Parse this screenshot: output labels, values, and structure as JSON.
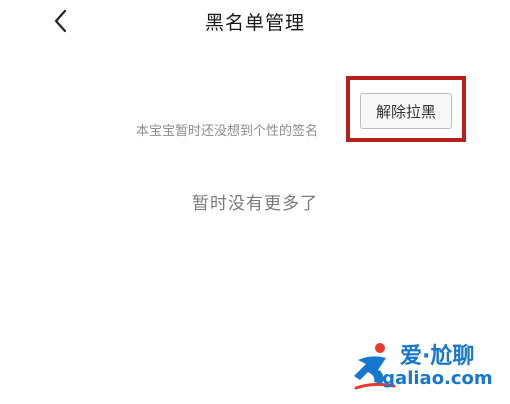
{
  "header": {
    "title": "黑名单管理",
    "back_icon": "chevron-left-icon"
  },
  "blocked_list": {
    "items": [
      {
        "signature": "本宝宝暂时还没想到个性的签名",
        "unblock_label": "解除拉黑"
      }
    ],
    "empty_message": "暂时没有更多了"
  },
  "annotation": {
    "highlight_color": "#b5201b"
  },
  "watermark": {
    "name": "爱·尬聊",
    "url": "igaliao.com",
    "color": "#1677cf",
    "accent": "#e8382f"
  }
}
